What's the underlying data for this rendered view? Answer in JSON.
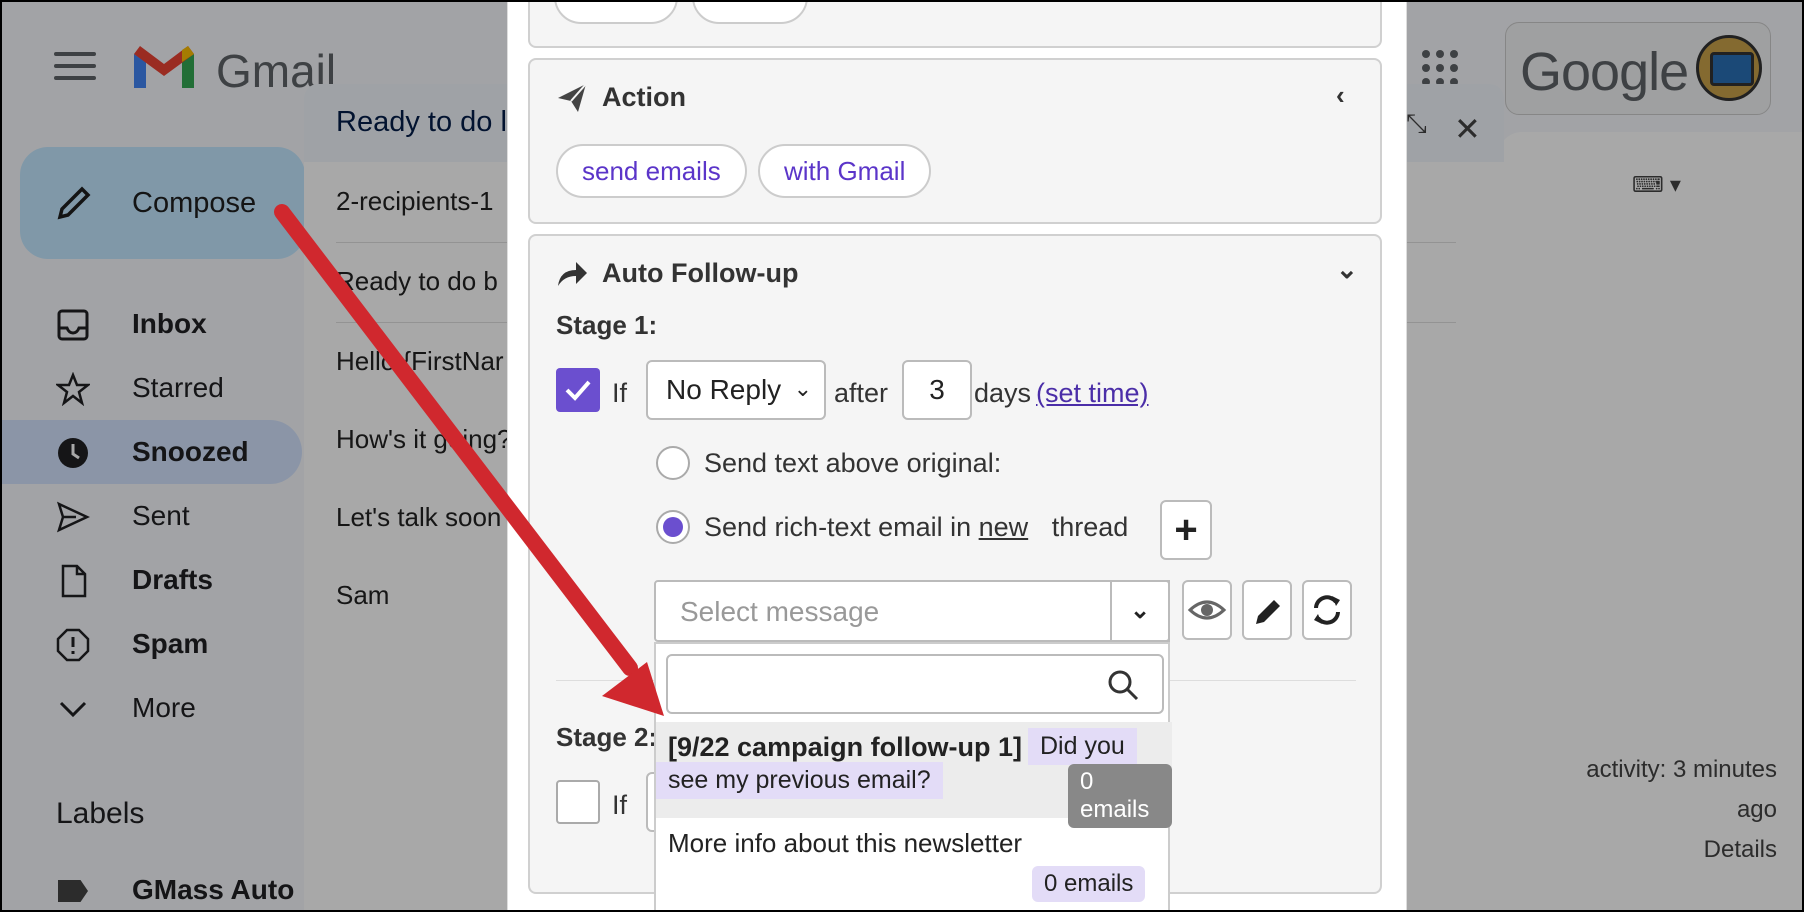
{
  "gmail": {
    "logo_text": "Gmail",
    "compose_label": "Compose",
    "nav": [
      {
        "label": "Inbox",
        "icon": "inbox-icon"
      },
      {
        "label": "Starred",
        "icon": "star-icon"
      },
      {
        "label": "Snoozed",
        "icon": "clock-icon"
      },
      {
        "label": "Sent",
        "icon": "send-icon"
      },
      {
        "label": "Drafts",
        "icon": "draft-icon"
      },
      {
        "label": "Spam",
        "icon": "spam-icon"
      },
      {
        "label": "More",
        "icon": "chevron-down-icon"
      }
    ],
    "labels_heading": "Labels",
    "label_item": "GMass Auto",
    "google_text": "Google",
    "activity": [
      "activity: 3 minutes",
      "ago",
      "Details"
    ]
  },
  "compose": {
    "title": "Ready to do l",
    "recipients": "2-recipients-1",
    "subject": "Ready to do b",
    "body": [
      "Hello {FirstNar",
      "How's it going?",
      "Let's talk soon",
      "Sam"
    ]
  },
  "gmass": {
    "action": {
      "title": "Action",
      "chips": [
        "send emails",
        "with Gmail"
      ]
    },
    "followup": {
      "title": "Auto Follow-up",
      "stage1": "Stage 1:",
      "if_label": "If",
      "condition": "No Reply",
      "after_label": "after",
      "days_value": "3",
      "days_label": "days",
      "set_time": "(set time)",
      "radio1": "Send text above original:",
      "radio2_pre": "Send rich-text email in",
      "radio2_new": "new",
      "radio2_post": "thread",
      "select_placeholder": "Select message",
      "stage2": "Stage 2:",
      "if_label2": "If"
    },
    "dropdown": {
      "item1_title": "[9/22 campaign follow-up 1]",
      "item1_subject_a": "Did you",
      "item1_subject_b": "see my previous email?",
      "item1_count": "0 emails",
      "item2_title": "More info about this newsletter",
      "item2_count": "0 emails"
    }
  },
  "colors": {
    "accent": "#6b4fcf",
    "arrow": "#d0282e",
    "link": "#5b35c9"
  }
}
